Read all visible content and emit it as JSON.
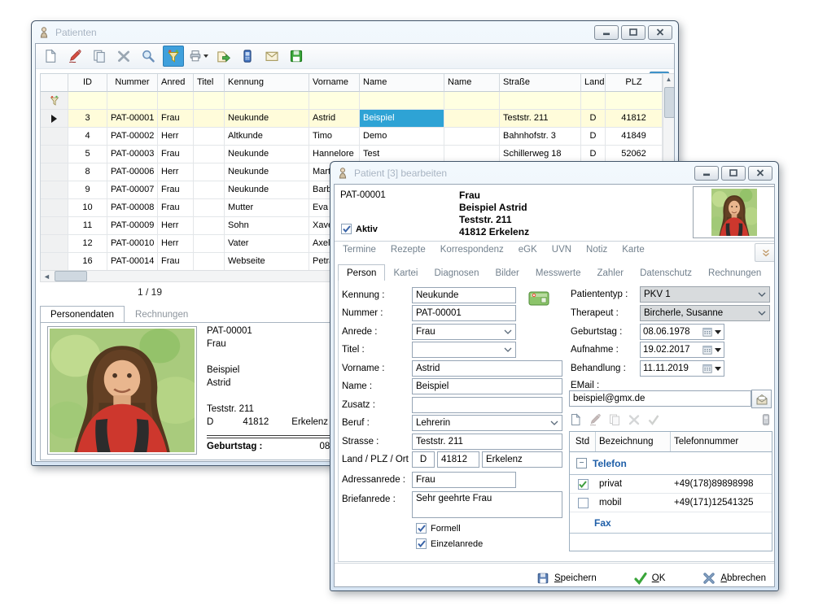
{
  "main_window": {
    "title": "Patienten",
    "toolbar_icons": [
      {
        "icon": "new-icon"
      },
      {
        "icon": "edit-icon"
      },
      {
        "icon": "copy-icon"
      },
      {
        "icon": "delete-icon"
      },
      {
        "icon": "search-icon"
      },
      {
        "icon": "filter-icon",
        "active": true
      },
      {
        "icon": "print-icon",
        "dropdown": true
      },
      {
        "icon": "export-icon"
      },
      {
        "icon": "phone-icon"
      },
      {
        "icon": "mail-icon"
      },
      {
        "icon": "save-icon"
      }
    ],
    "help_icon": "help-icon",
    "grid": {
      "columns": [
        "ID",
        "Nummer",
        "Anred",
        "Titel",
        "Kennung",
        "Vorname",
        "Name",
        "Name",
        "Straße",
        "Land",
        "PLZ"
      ],
      "rows": [
        {
          "id": "3",
          "nummer": "PAT-00001",
          "anred": "Frau",
          "titel": "",
          "kennung": "Neukunde",
          "vorname": "Astrid",
          "name": "Beispiel",
          "name2": "",
          "strasse": "Teststr. 211",
          "land": "D",
          "plz": "41812",
          "selected": true
        },
        {
          "id": "4",
          "nummer": "PAT-00002",
          "anred": "Herr",
          "titel": "",
          "kennung": "Altkunde",
          "vorname": "Timo",
          "name": "Demo",
          "name2": "",
          "strasse": "Bahnhofstr. 3",
          "land": "D",
          "plz": "41849"
        },
        {
          "id": "5",
          "nummer": "PAT-00003",
          "anred": "Frau",
          "titel": "",
          "kennung": "Neukunde",
          "vorname": "Hannelore",
          "name": "Test",
          "name2": "",
          "strasse": "Schillerweg 18",
          "land": "D",
          "plz": "52062"
        },
        {
          "id": "8",
          "nummer": "PAT-00006",
          "anred": "Herr",
          "titel": "",
          "kennung": "Neukunde",
          "vorname": "Martin",
          "name": "",
          "name2": "",
          "strasse": "",
          "land": "",
          "plz": ""
        },
        {
          "id": "9",
          "nummer": "PAT-00007",
          "anred": "Frau",
          "titel": "",
          "kennung": "Neukunde",
          "vorname": "Barbara",
          "name": "",
          "name2": "",
          "strasse": "",
          "land": "",
          "plz": ""
        },
        {
          "id": "10",
          "nummer": "PAT-00008",
          "anred": "Frau",
          "titel": "",
          "kennung": "Mutter",
          "vorname": "Eva",
          "name": "",
          "name2": "",
          "strasse": "",
          "land": "",
          "plz": ""
        },
        {
          "id": "11",
          "nummer": "PAT-00009",
          "anred": "Herr",
          "titel": "",
          "kennung": "Sohn",
          "vorname": "Xaver",
          "name": "",
          "name2": "",
          "strasse": "",
          "land": "",
          "plz": ""
        },
        {
          "id": "12",
          "nummer": "PAT-00010",
          "anred": "Herr",
          "titel": "",
          "kennung": "Vater",
          "vorname": "Axel",
          "name": "",
          "name2": "",
          "strasse": "",
          "land": "",
          "plz": ""
        },
        {
          "id": "16",
          "nummer": "PAT-00014",
          "anred": "Frau",
          "titel": "",
          "kennung": "Webseite",
          "vorname": "Petra",
          "name": "",
          "name2": "",
          "strasse": "",
          "land": "",
          "plz": ""
        }
      ],
      "selected_column": "name"
    },
    "pager": "1 / 19",
    "detail_tabs": [
      {
        "label": "Personendaten",
        "active": true
      },
      {
        "label": "Rechnungen",
        "active": false
      }
    ],
    "detail": {
      "lines": [
        "PAT-00001",
        "Frau",
        "",
        "Beispiel",
        "Astrid",
        "",
        "Teststr. 211"
      ],
      "land": "D",
      "plz": "41812",
      "ort": "Erkelenz",
      "birthday_label": "Geburtstag :",
      "birthday": "08.06.1978"
    }
  },
  "edit_window": {
    "title": "Patient [3] bearbeiten",
    "patient_number": "PAT-00001",
    "aktiv_label": "Aktiv",
    "aktiv_checked": true,
    "address_lines": [
      "Frau",
      "Beispiel Astrid",
      "Teststr. 211",
      "41812 Erkelenz"
    ],
    "link_tabs": [
      "Termine",
      "Rezepte",
      "Korrespondenz",
      "eGK",
      "UVN",
      "Notiz",
      "Karte"
    ],
    "tabs": [
      {
        "label": "Person",
        "active": true
      },
      {
        "label": "Kartei"
      },
      {
        "label": "Diagnosen"
      },
      {
        "label": "Bilder"
      },
      {
        "label": "Messwerte"
      },
      {
        "label": "Zahler"
      },
      {
        "label": "Datenschutz"
      },
      {
        "label": "Rechnungen"
      }
    ],
    "form": {
      "kennung": {
        "label": "Kennung :",
        "value": "Neukunde"
      },
      "nummer": {
        "label": "Nummer :",
        "value": "PAT-00001"
      },
      "anrede": {
        "label": "Anrede :",
        "value": "Frau"
      },
      "titel": {
        "label": "Titel :",
        "value": ""
      },
      "vorname": {
        "label": "Vorname :",
        "value": "Astrid"
      },
      "name": {
        "label": "Name :",
        "value": "Beispiel"
      },
      "zusatz": {
        "label": "Zusatz :",
        "value": ""
      },
      "beruf": {
        "label": "Beruf :",
        "value": "Lehrerin"
      },
      "strasse": {
        "label": "Strasse :",
        "value": "Teststr. 211"
      },
      "land_plz_ort": {
        "label": "Land / PLZ / Ort :",
        "land": "D",
        "plz": "41812",
        "ort": "Erkelenz"
      },
      "adressanrede": {
        "label": "Adressanrede :",
        "value": "Frau"
      },
      "briefanrede": {
        "label": "Briefanrede :",
        "value": "Sehr geehrte Frau"
      },
      "formell": {
        "label": "Formell",
        "checked": true
      },
      "einzelanrede": {
        "label": "Einzelanrede",
        "checked": true
      }
    },
    "right_form": {
      "patiententyp": {
        "label": "Patiententyp :",
        "value": "PKV 1"
      },
      "therapeut": {
        "label": "Therapeut :",
        "value": "Bircherle, Susanne"
      },
      "geburtstag": {
        "label": "Geburtstag :",
        "value": "08.06.1978"
      },
      "aufnahme": {
        "label": "Aufnahme :",
        "value": "19.02.2017"
      },
      "behandlung": {
        "label": "Behandlung :",
        "value": "11.11.2019"
      },
      "email": {
        "label": "EMail :",
        "value": "beispiel@gmx.de"
      }
    },
    "phone_section": {
      "toolbar_icons": [
        {
          "icon": "new-icon"
        },
        {
          "icon": "edit-icon",
          "dim": true
        },
        {
          "icon": "copy-icon",
          "dim": true
        },
        {
          "icon": "delete-icon",
          "dim": true
        },
        {
          "icon": "apply-icon",
          "dim": true
        }
      ],
      "phone_icon": "phone-icon",
      "columns": [
        "Std",
        "Bezeichnung",
        "Telefonnummer"
      ],
      "groups": [
        {
          "name": "Telefon",
          "has_minus_box": true,
          "rows": [
            {
              "std": true,
              "bezeichnung": "privat",
              "telefonnummer": "+49(178)89898998"
            },
            {
              "std": false,
              "bezeichnung": "mobil",
              "telefonnummer": "+49(171)12541325"
            }
          ]
        },
        {
          "name": "Fax",
          "has_minus_box": false,
          "rows": []
        }
      ]
    },
    "dialog_buttons": [
      {
        "label": "Speichern",
        "icon": "save-blue-icon"
      },
      {
        "label": "OK",
        "icon": "ok-icon"
      },
      {
        "label": "Abbrechen",
        "icon": "cancel-icon"
      }
    ]
  }
}
